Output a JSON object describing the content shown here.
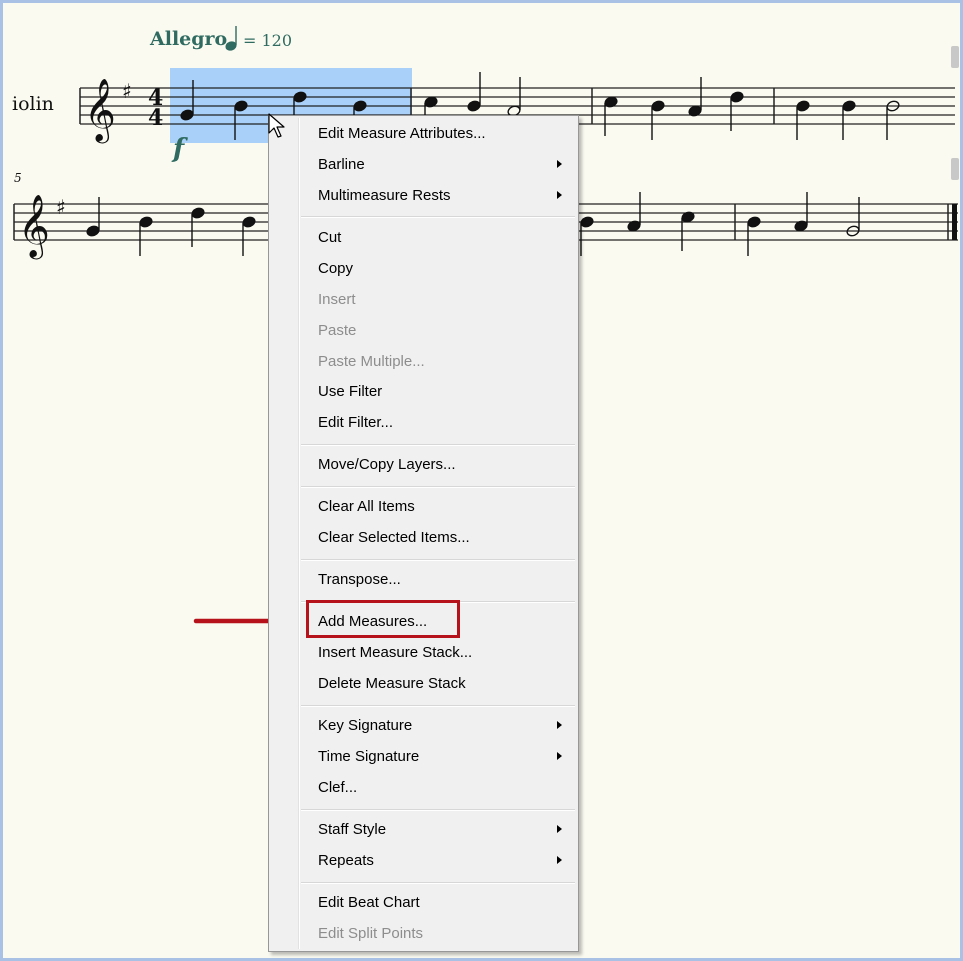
{
  "score": {
    "tempo_text": "Allegro",
    "tempo_value": "= 120",
    "instrument": "iolin",
    "measure_number": "5",
    "dynamic": "f"
  },
  "context_menu": {
    "items": [
      {
        "label": "Edit Measure Attributes...",
        "enabled": true,
        "submenu": false
      },
      {
        "label": "Barline",
        "enabled": true,
        "submenu": true
      },
      {
        "label": "Multimeasure Rests",
        "enabled": true,
        "submenu": true
      },
      {
        "label": "Cut",
        "enabled": true,
        "submenu": false
      },
      {
        "label": "Copy",
        "enabled": true,
        "submenu": false
      },
      {
        "label": "Insert",
        "enabled": false,
        "submenu": false
      },
      {
        "label": "Paste",
        "enabled": false,
        "submenu": false
      },
      {
        "label": "Paste Multiple...",
        "enabled": false,
        "submenu": false
      },
      {
        "label": "Use Filter",
        "enabled": true,
        "submenu": false
      },
      {
        "label": "Edit Filter...",
        "enabled": true,
        "submenu": false
      },
      {
        "label": "Move/Copy Layers...",
        "enabled": true,
        "submenu": false
      },
      {
        "label": "Clear All Items",
        "enabled": true,
        "submenu": false
      },
      {
        "label": "Clear Selected Items...",
        "enabled": true,
        "submenu": false
      },
      {
        "label": "Transpose...",
        "enabled": true,
        "submenu": false
      },
      {
        "label": "Add Measures...",
        "enabled": true,
        "submenu": false,
        "highlighted": true
      },
      {
        "label": "Insert Measure Stack...",
        "enabled": true,
        "submenu": false
      },
      {
        "label": "Delete Measure Stack",
        "enabled": true,
        "submenu": false
      },
      {
        "label": "Key Signature",
        "enabled": true,
        "submenu": true
      },
      {
        "label": "Time Signature",
        "enabled": true,
        "submenu": true
      },
      {
        "label": "Clef...",
        "enabled": true,
        "submenu": false
      },
      {
        "label": "Staff Style",
        "enabled": true,
        "submenu": true
      },
      {
        "label": "Repeats",
        "enabled": true,
        "submenu": true
      },
      {
        "label": "Edit Beat Chart",
        "enabled": true,
        "submenu": false
      },
      {
        "label": "Edit Split Points",
        "enabled": false,
        "submenu": false
      }
    ]
  },
  "colors": {
    "paper": "#fbfaf1",
    "selection": "#9ecbfa",
    "annotation_red": "#b5121b",
    "expression_teal": "#2f6b60"
  }
}
